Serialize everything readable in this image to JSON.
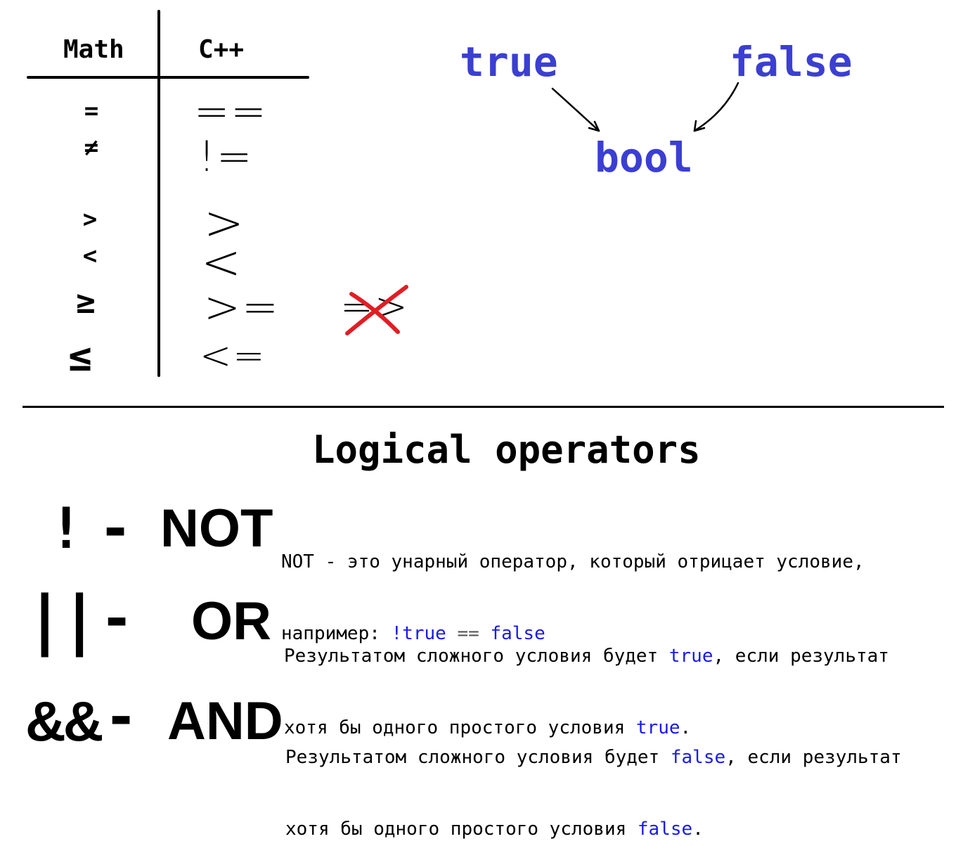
{
  "table": {
    "header_math": "Math",
    "header_cpp": "C++",
    "rows": [
      {
        "math": "=",
        "cpp": "=="
      },
      {
        "math": "≠",
        "cpp": "!="
      },
      {
        "math": ">",
        "cpp": ">"
      },
      {
        "math": "<",
        "cpp": "<"
      },
      {
        "math": "≥",
        "cpp": ">="
      },
      {
        "math": "≤",
        "cpp": "<="
      }
    ],
    "crossed_out": "=>"
  },
  "bool_diagram": {
    "true_label": "true",
    "false_label": "false",
    "bool_label": "bool"
  },
  "logical": {
    "title": "Logical operators",
    "not": {
      "symbol": "!",
      "dash": "-",
      "name": "NOT",
      "line1": "NOT - это унарный оператор, который отрицает условие,",
      "line2_prefix": "например: ",
      "line2_excl": "!",
      "line2_true": "true",
      "line2_eq": " == ",
      "line2_false": "false"
    },
    "or": {
      "symbol": "||",
      "dash": "-",
      "name": "OR",
      "line1_prefix": "Результатом сложного условия будет ",
      "line1_kw": "true",
      "line1_suffix": ", если результат",
      "line2_prefix": "хотя бы одного простого условия ",
      "line2_kw": "true",
      "line2_suffix": "."
    },
    "and": {
      "symbol": "&&",
      "dash": "-",
      "name": "AND",
      "line1_prefix": "Результатом сложного условия будет ",
      "line1_kw": "false",
      "line1_suffix": ", если результат",
      "line2_prefix": "хотя бы одного простого условия ",
      "line2_kw": "false",
      "line2_suffix": "."
    }
  },
  "colors": {
    "blue_label": "#3b3fd2",
    "keyword": "#1a1ae6",
    "cross": "#e01e24"
  }
}
